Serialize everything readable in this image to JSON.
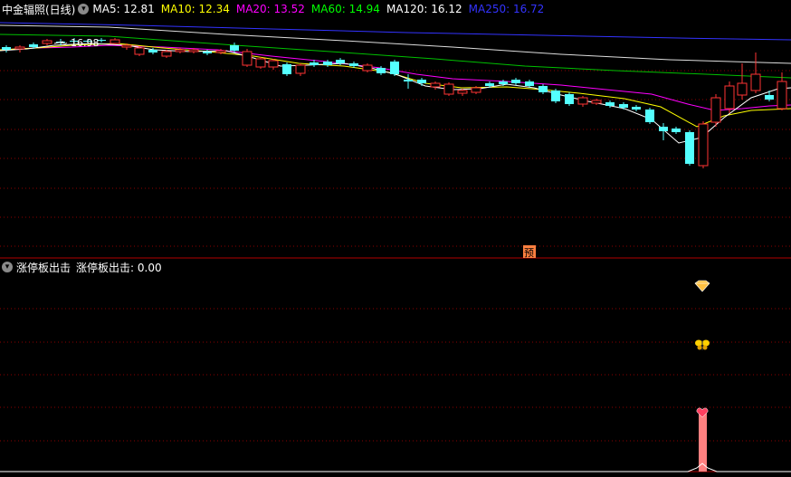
{
  "main_panel": {
    "title": "中金辐照(日线)",
    "ma": [
      {
        "label": "MA5: 12.81",
        "color": "#ffffff"
      },
      {
        "label": "MA10: 12.34",
        "color": "#ffff00"
      },
      {
        "label": "MA20: 13.52",
        "color": "#ff00ff"
      },
      {
        "label": "MA60: 14.94",
        "color": "#00ff00"
      },
      {
        "label": "MA120: 16.12",
        "color": "#ffffff"
      },
      {
        "label": "MA250: 16.72",
        "color": "#3333ff"
      }
    ],
    "max_price_label": "16.98",
    "pre_marker": "预"
  },
  "sub_panel": {
    "title": "涨停板出击",
    "value_text": "涨停板出击: 0.00"
  },
  "colors": {
    "up": "#ff3333",
    "down": "#54ffff",
    "grid": "#8b0000",
    "bar": "#ff8080"
  },
  "icons": [
    "chevron-down-icon",
    "diamond-icon",
    "butterfly-icon",
    "heart-icon"
  ]
}
